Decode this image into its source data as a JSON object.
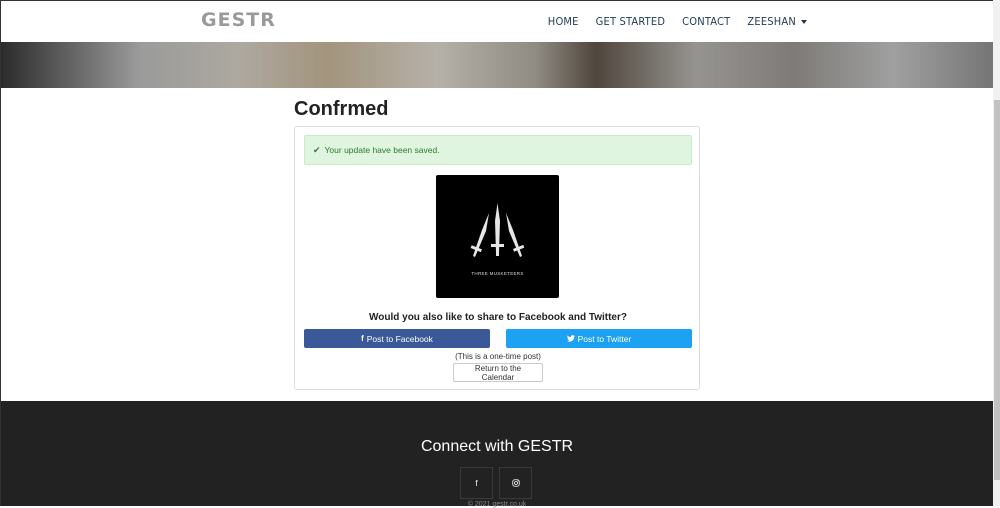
{
  "nav": {
    "brand": "GESTR",
    "links": [
      "HOME",
      "GET STARTED",
      "CONTACT",
      "ZEESHAN"
    ]
  },
  "main": {
    "title": "Confrmed",
    "alert": "Your update have been saved.",
    "logo_caption": "THREE MUSKETEERS",
    "share_question": "Would you also like to share to Facebook and Twitter?",
    "facebook_button": "Post to Facebook",
    "twitter_button": "Post to Twitter",
    "one_time_note": "(This is a one-time post)",
    "return_button": "Return to the Calendar"
  },
  "footer": {
    "title": "Connect with GESTR",
    "facebook_glyph": "f",
    "copyright": "© 2021 gestr.co.uk"
  },
  "colors": {
    "facebook": "#3b5998",
    "twitter": "#1da1f2",
    "alert_bg": "#dff5df",
    "footer_bg": "#222222"
  },
  "icons": [
    "check-icon",
    "facebook-icon",
    "twitter-icon",
    "instagram-icon",
    "caret-down-icon"
  ]
}
